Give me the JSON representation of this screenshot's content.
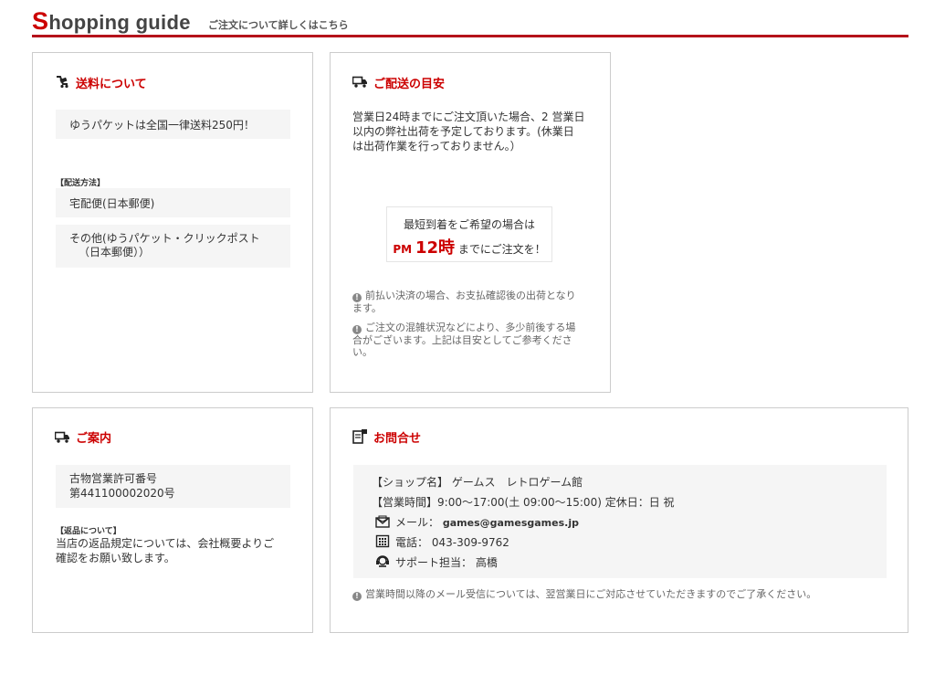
{
  "header": {
    "brand_initial": "S",
    "brand_rest": "hopping guide",
    "subtitle": "ご注文について詳しくはこちら"
  },
  "shipping": {
    "title": "送料について",
    "fee_text": "ゆうパケットは全国一律送料250円！",
    "method_label": "【配送方法】",
    "method_1": "宅配便(日本郵便)",
    "method_2_line1": "その他(ゆうパケット・クリックポスト",
    "method_2_line2": "（日本郵便））"
  },
  "delivery": {
    "title": "ご配送の目安",
    "line1": "営業日24時までにご注文頂いた場合、2 営業日",
    "line2": "以内の弊社出荷を予定しております。(休業日",
    "line3": "は出荷作業を行っておりません。）",
    "highlight_line": "最短到着をご希望の場合は",
    "highlight_pm": "PM",
    "highlight_time": "12時",
    "highlight_suffix": "までにご注文を！",
    "note1_line1": "前払い決済の場合、お支払確認後の出荷となり",
    "note1_line2": "ます。",
    "note2_line1": "ご注文の混雑状況などにより、多少前後する場",
    "note2_line2": "合がございます。上記は目安としてご参考くださ",
    "note2_line3": "い。"
  },
  "guide": {
    "title": "ご案内",
    "license_line1": "古物営業許可番号",
    "license_line2": "第441100002020号",
    "returns_label": "【返品について】",
    "returns_line1": "当店の返品規定については、会社概要よりご",
    "returns_line2": "確認をお願い致します。"
  },
  "contact": {
    "title": "お問合せ",
    "shop_label": "【ショップ名】",
    "shop_name": "ゲームス　レトロゲーム館",
    "hours_label": "【営業時間】",
    "hours_value": "9:00～17:00(土 09:00～15:00) 定休日：日 祝",
    "mail_label": "メール：",
    "mail_value": "games@gamesgames.jp",
    "phone_label": "電話：",
    "phone_value": "043-309-9762",
    "support_label": "サポート担当：",
    "support_value": "高橋",
    "note": "営業時間以降のメール受信については、翌営業日にご対応させていただきますのでご了承ください。"
  },
  "icons": {
    "shipping": "shipping-fee-icon",
    "truck": "truck-icon",
    "truck_guide": "truck-icon",
    "contact": "inquiry-icon",
    "mail": "mail-icon",
    "phone": "phone-icon",
    "support": "headset-icon",
    "info": "info-icon"
  },
  "colors": {
    "accent": "#c00000",
    "box_bg": "#f5f5f5",
    "border": "#cccccc"
  }
}
